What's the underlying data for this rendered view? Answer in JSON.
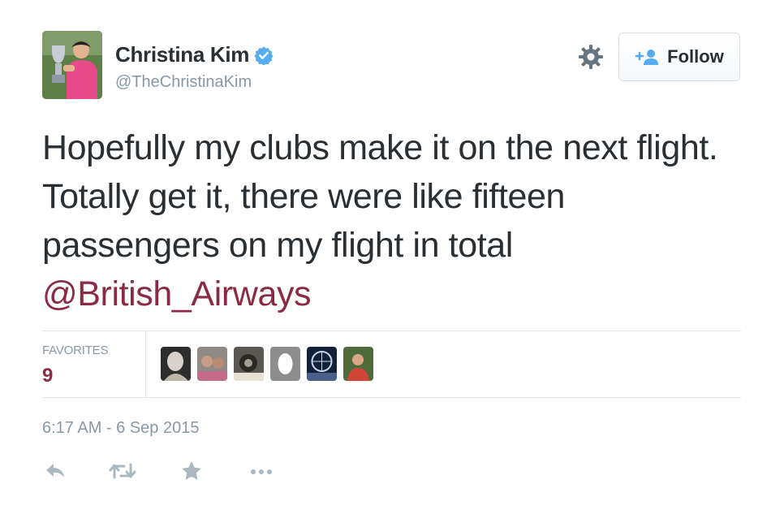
{
  "user": {
    "display_name": "Christina Kim",
    "handle": "@TheChristinaKim",
    "verified": true,
    "avatar_icon": "user-avatar"
  },
  "header": {
    "settings_icon": "gear-icon",
    "follow_label": "Follow",
    "follow_icon": "add-user-icon"
  },
  "tweet": {
    "lines": [
      "Hopefully my clubs make it on the next flight.",
      "Totally get it, there were like fifteen",
      "passengers on my flight in total"
    ],
    "mention": "@British_Airways"
  },
  "stats": {
    "favorites_label": "FAVORITES",
    "favorites_count": "9",
    "favoriter_avatars": [
      "user-avatar",
      "user-avatar",
      "user-avatar",
      "user-avatar",
      "user-avatar",
      "user-avatar"
    ]
  },
  "meta": {
    "timestamp": "6:17 AM - 6 Sep 2015"
  },
  "actions": {
    "icons": [
      "reply-icon",
      "retweet-icon",
      "favorite-icon",
      "more-icon"
    ]
  },
  "colors": {
    "text": "#292f33",
    "muted": "#8899a6",
    "link": "#8b2a45",
    "verified": "#55acee",
    "divider": "#e1e8ed",
    "action_icon": "#aab8c2"
  }
}
